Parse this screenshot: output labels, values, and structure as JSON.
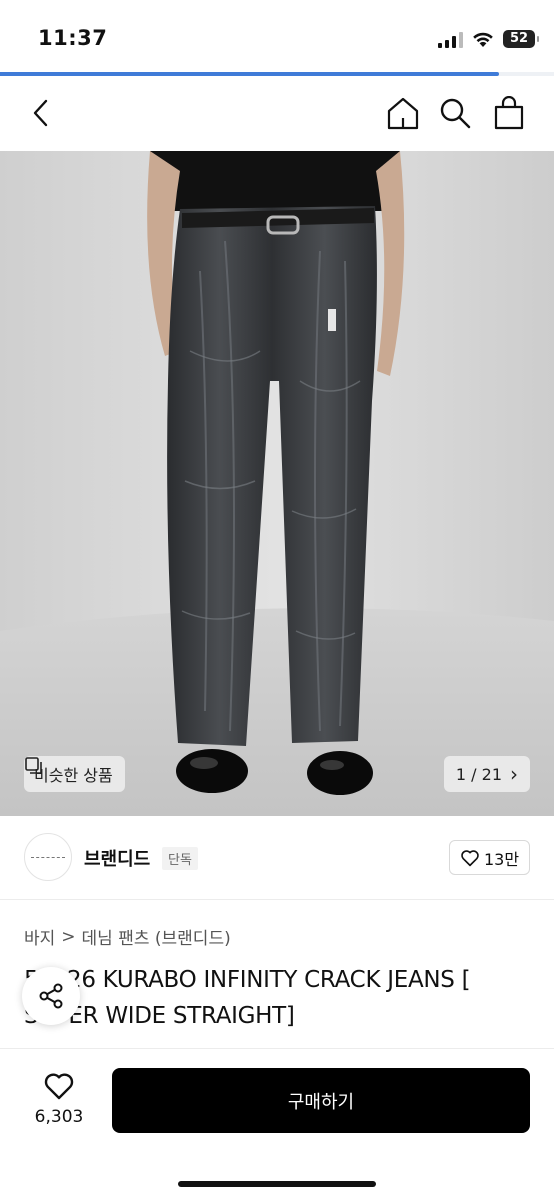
{
  "status_bar": {
    "time": "11:37",
    "battery": "52"
  },
  "page_load_progress": 0.9,
  "nav": {
    "icons": [
      "back-icon",
      "home-icon",
      "search-icon",
      "bag-icon"
    ]
  },
  "hero": {
    "similar_label": "비슷한 상품",
    "counter": "1 / 21",
    "counter_arrow": "›"
  },
  "brand": {
    "name": "브랜디드",
    "tag": "단독",
    "likes": "13만"
  },
  "breadcrumb": {
    "category": "바지",
    "separator": ">",
    "subcategory": "데님 팬츠 (브랜디드)"
  },
  "product": {
    "title_line1": "51026 KURABO INFINITY CRACK JEANS [",
    "title_line2": "SUPER WIDE STRAIGHT]"
  },
  "bottom_bar": {
    "wish_count": "6,303",
    "buy_label": "구매하기"
  },
  "colors": {
    "accent": "#3f7bd8",
    "buy": "#000000",
    "text": "#111111"
  }
}
